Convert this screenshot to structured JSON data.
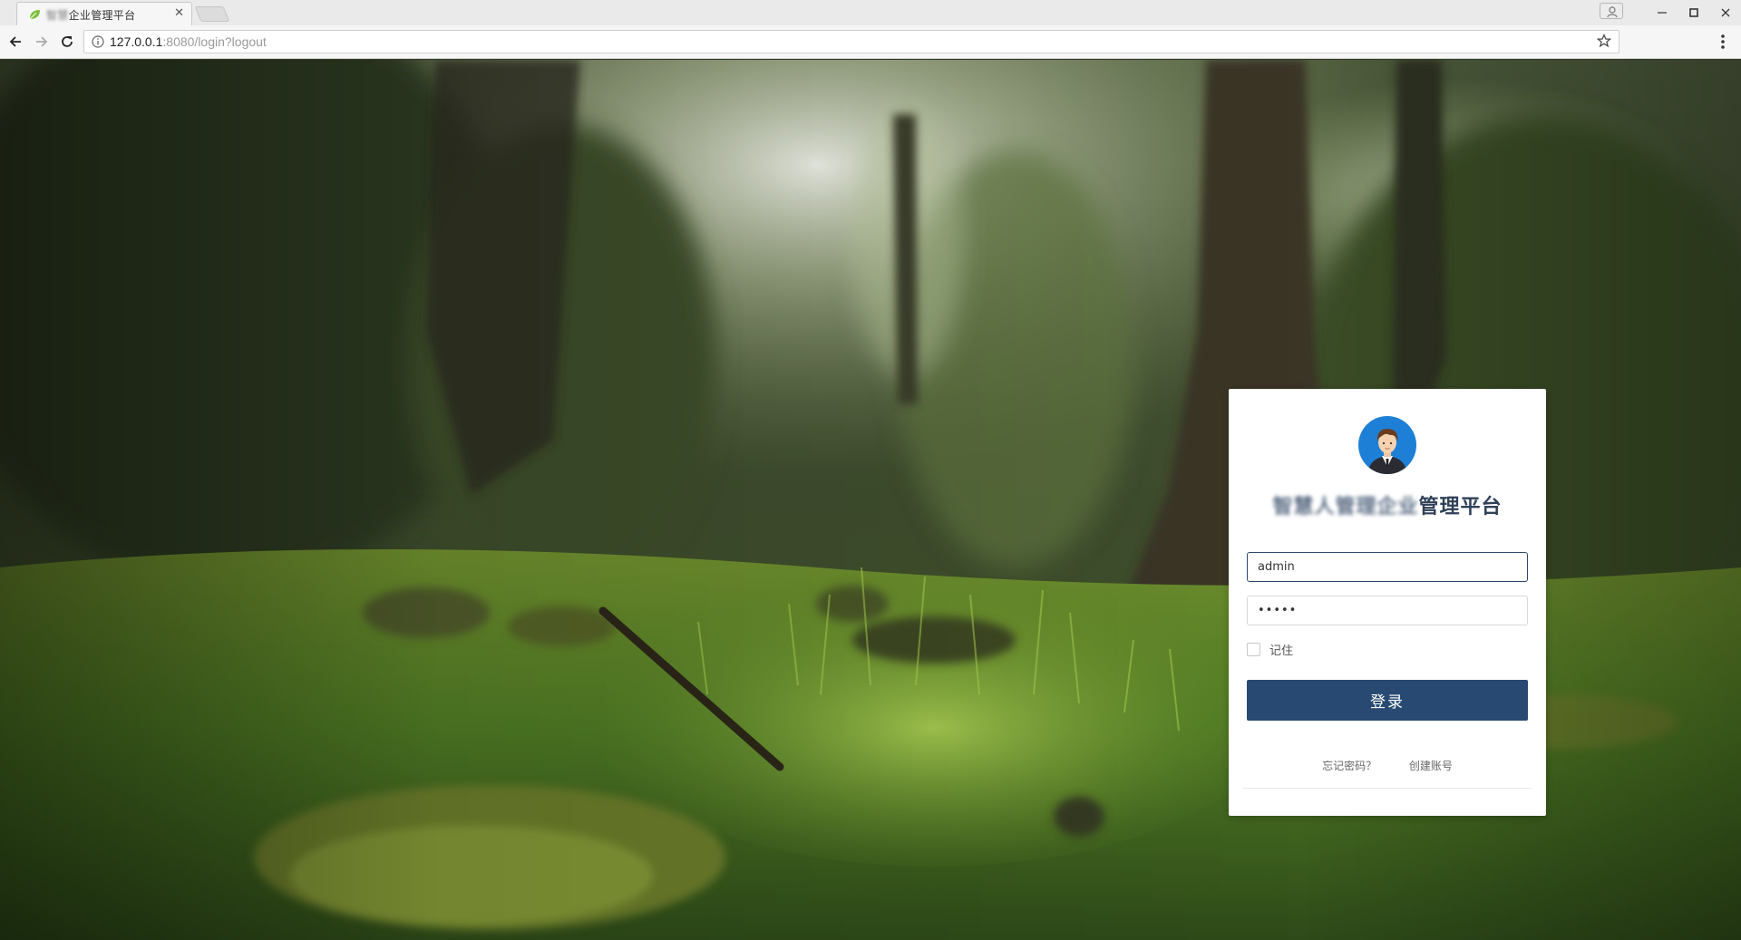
{
  "browser": {
    "tab_title_blurred": "智慧",
    "tab_title": "企业管理平台",
    "url_host": "127.0.0.1",
    "url_path": ":8080/login?logout"
  },
  "icons": {
    "favicon": "leaf-icon",
    "back": "arrow-left-icon",
    "forward": "arrow-right-icon",
    "reload": "reload-icon",
    "info": "info-icon",
    "bookmark": "star-icon",
    "menu": "kebab-menu-icon",
    "profile": "user-profile-icon"
  },
  "login": {
    "title_blurred": "智慧人管理企业",
    "title_visible": "管理平台",
    "username_value": "admin",
    "password_value": "•••••",
    "remember_label": "记住",
    "login_button": "登录",
    "forgot_password": "忘记密码？",
    "create_account": "创建账号"
  },
  "colors": {
    "button": "#284a72",
    "title": "#2f4057",
    "focus_border": "#2d4a6e",
    "avatar_bg": "#1e7fd6"
  }
}
